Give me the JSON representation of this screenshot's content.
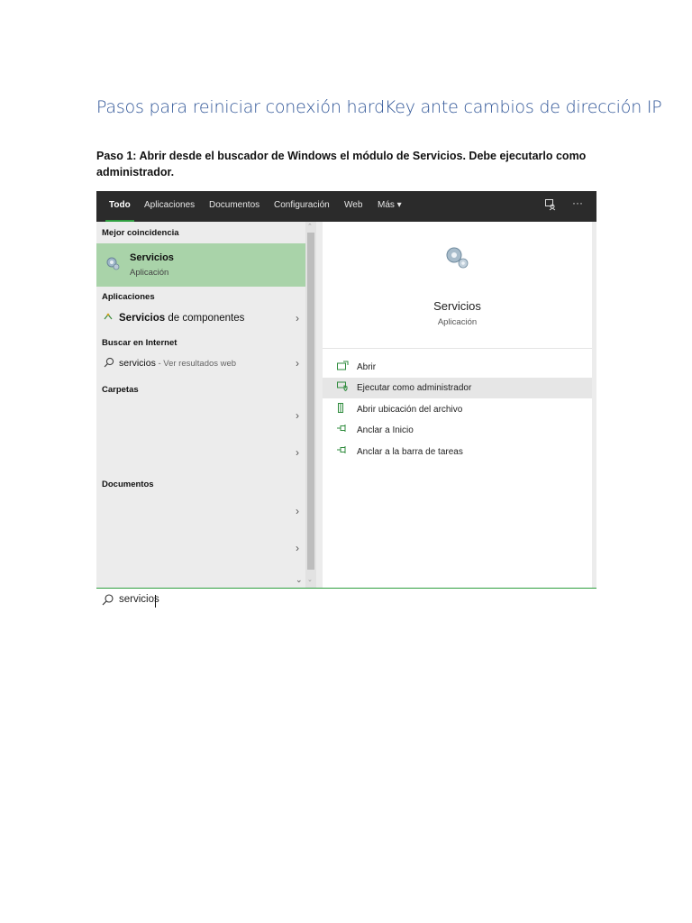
{
  "document": {
    "title": "Pasos para reiniciar conexión hardKey ante cambios de dirección IP",
    "step1": "Paso 1: Abrir desde el buscador de Windows el módulo de Servicios. Debe ejecutarlo como administrador."
  },
  "topbar": {
    "tabs": [
      {
        "label": "Todo"
      },
      {
        "label": "Aplicaciones"
      },
      {
        "label": "Documentos"
      },
      {
        "label": "Configuración"
      },
      {
        "label": "Web"
      },
      {
        "label": "Más ▾"
      }
    ],
    "feedback_icon": "feedback-icon",
    "more_label": "···"
  },
  "results": {
    "best_match_header": "Mejor coincidencia",
    "best_match": {
      "name": "Servicios",
      "type": "Aplicación"
    },
    "apps_header": "Aplicaciones",
    "app_item": {
      "bold": "Servicios",
      "rest": " de componentes"
    },
    "internet_header": "Buscar en Internet",
    "web_item": {
      "query": "servicios",
      "hint": " - Ver resultados web"
    },
    "folders_header": "Carpetas",
    "documents_header": "Documentos"
  },
  "detail": {
    "title": "Servicios",
    "subtitle": "Aplicación",
    "actions": [
      {
        "label": "Abrir",
        "icon": "open-icon"
      },
      {
        "label": "Ejecutar como administrador",
        "icon": "shield-icon",
        "highlighted": true
      },
      {
        "label": "Abrir ubicación del archivo",
        "icon": "folder-icon"
      },
      {
        "label": "Anclar a Inicio",
        "icon": "pin-icon"
      },
      {
        "label": "Anclar a la barra de tareas",
        "icon": "pin-icon"
      }
    ]
  },
  "search": {
    "value": "servicios"
  },
  "colors": {
    "accent": "#2e9e3f",
    "highlight": "#a9d3a9",
    "topbar": "#2b2b2b",
    "title": "#2f5597"
  }
}
